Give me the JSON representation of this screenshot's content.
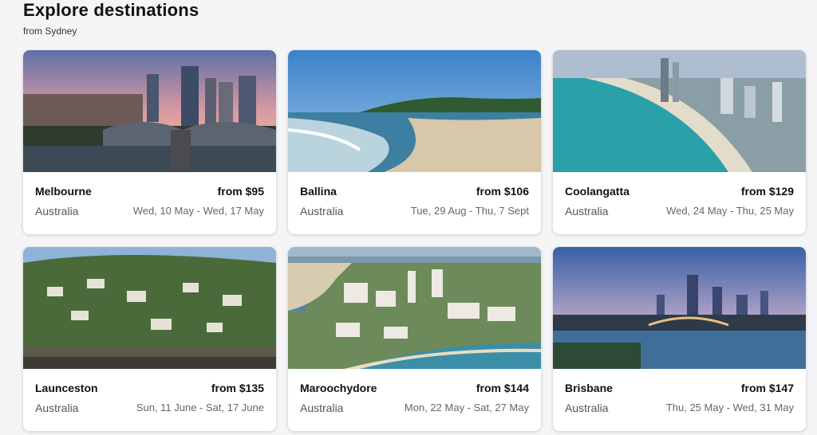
{
  "header": {
    "title": "Explore destinations",
    "subtitle": "from Sydney"
  },
  "cards": [
    {
      "city": "Melbourne",
      "price": "from $95",
      "country": "Australia",
      "dates": "Wed, 10 May - Wed, 17 May"
    },
    {
      "city": "Ballina",
      "price": "from $106",
      "country": "Australia",
      "dates": "Tue, 29 Aug - Thu, 7 Sept"
    },
    {
      "city": "Coolangatta",
      "price": "from $129",
      "country": "Australia",
      "dates": "Wed, 24 May - Thu, 25 May"
    },
    {
      "city": "Launceston",
      "price": "from $135",
      "country": "Australia",
      "dates": "Sun, 11 June - Sat, 17 June"
    },
    {
      "city": "Maroochydore",
      "price": "from $144",
      "country": "Australia",
      "dates": "Mon, 22 May - Sat, 27 May"
    },
    {
      "city": "Brisbane",
      "price": "from $147",
      "country": "Australia",
      "dates": "Thu, 25 May - Wed, 31 May"
    }
  ]
}
